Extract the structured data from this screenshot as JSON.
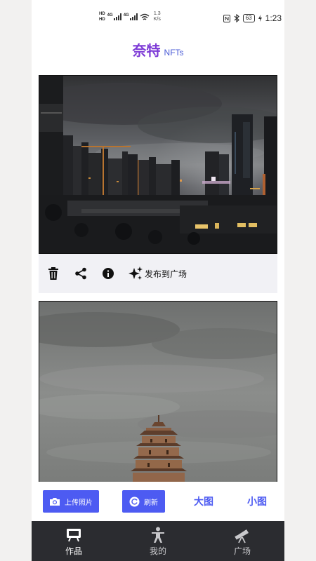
{
  "status_bar": {
    "hd1": "HD",
    "hd2": "HD",
    "signal1_label": "4G",
    "signal2_label": "4G",
    "net_speed_value": "1.3",
    "net_speed_unit": "K/s",
    "battery": "63",
    "time": "1:23"
  },
  "header": {
    "title": "奈特",
    "subtitle": "NFTs"
  },
  "feed": {
    "actions": {
      "publish_label": "发布到广场"
    }
  },
  "bottom_actions": {
    "upload_label": "上传照片",
    "refresh_label": "刷新",
    "large_label": "大图",
    "small_label": "小图"
  },
  "tabbar": {
    "tabs": [
      {
        "label": "作品",
        "icon": "easel-icon",
        "active": true
      },
      {
        "label": "我的",
        "icon": "person-icon",
        "active": false
      },
      {
        "label": "广场",
        "icon": "telescope-icon",
        "active": false
      }
    ]
  },
  "colors": {
    "brand_purple": "#7d3ad6",
    "accent_blue": "#4d5bf2",
    "tabbar_bg": "#2b2c30"
  }
}
